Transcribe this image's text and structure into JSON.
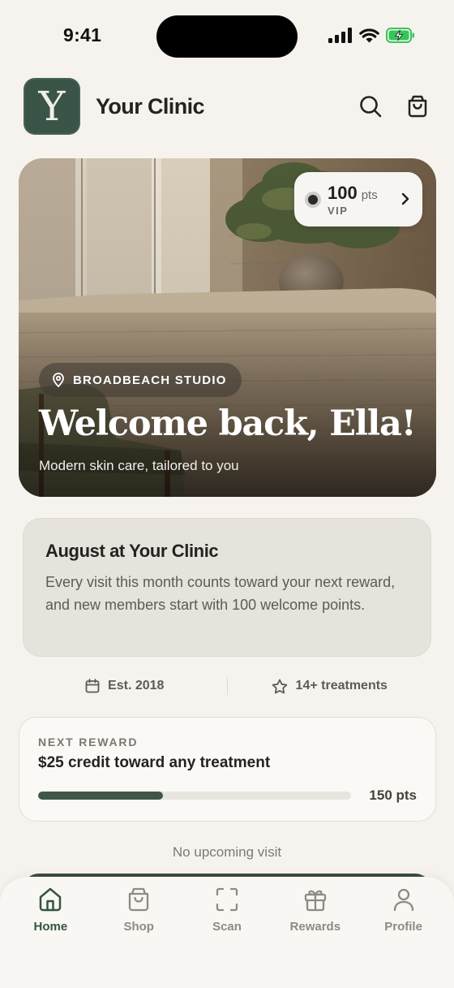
{
  "status_bar": {
    "time": "9:41"
  },
  "header": {
    "logo_letter": "Y",
    "app_name": "Your Clinic",
    "search_icon": "search-icon",
    "bag_icon": "shopping-bag-icon"
  },
  "hero": {
    "points_value": "100",
    "points_unit": "pts",
    "tier": "VIP",
    "location": "BROADBEACH STUDIO",
    "title": "Welcome back, Ella!",
    "subtitle": "Modern skin care, tailored to you"
  },
  "promo": {
    "title": "August at Your Clinic",
    "body": "Every visit this month counts toward your next reward, and new members start with 100 welcome points."
  },
  "stats": {
    "established": "Est. 2018",
    "treatments": "14+ treatments"
  },
  "reward": {
    "kicker": "NEXT REWARD",
    "title": "$25 credit toward any treatment",
    "target": "150 pts",
    "progress_fraction": 0.4
  },
  "upcoming": {
    "empty_text": "No upcoming visit"
  },
  "tabs": [
    {
      "label": "Home",
      "icon": "home-icon",
      "active": true
    },
    {
      "label": "Shop",
      "icon": "shopping-bag-icon",
      "active": false
    },
    {
      "label": "Scan",
      "icon": "scan-icon",
      "active": false
    },
    {
      "label": "Rewards",
      "icon": "gift-icon",
      "active": false
    },
    {
      "label": "Profile",
      "icon": "user-icon",
      "active": false
    }
  ],
  "colors": {
    "brand": "#3a5447",
    "background": "#f6f3ee",
    "progress": "#3f5548"
  }
}
